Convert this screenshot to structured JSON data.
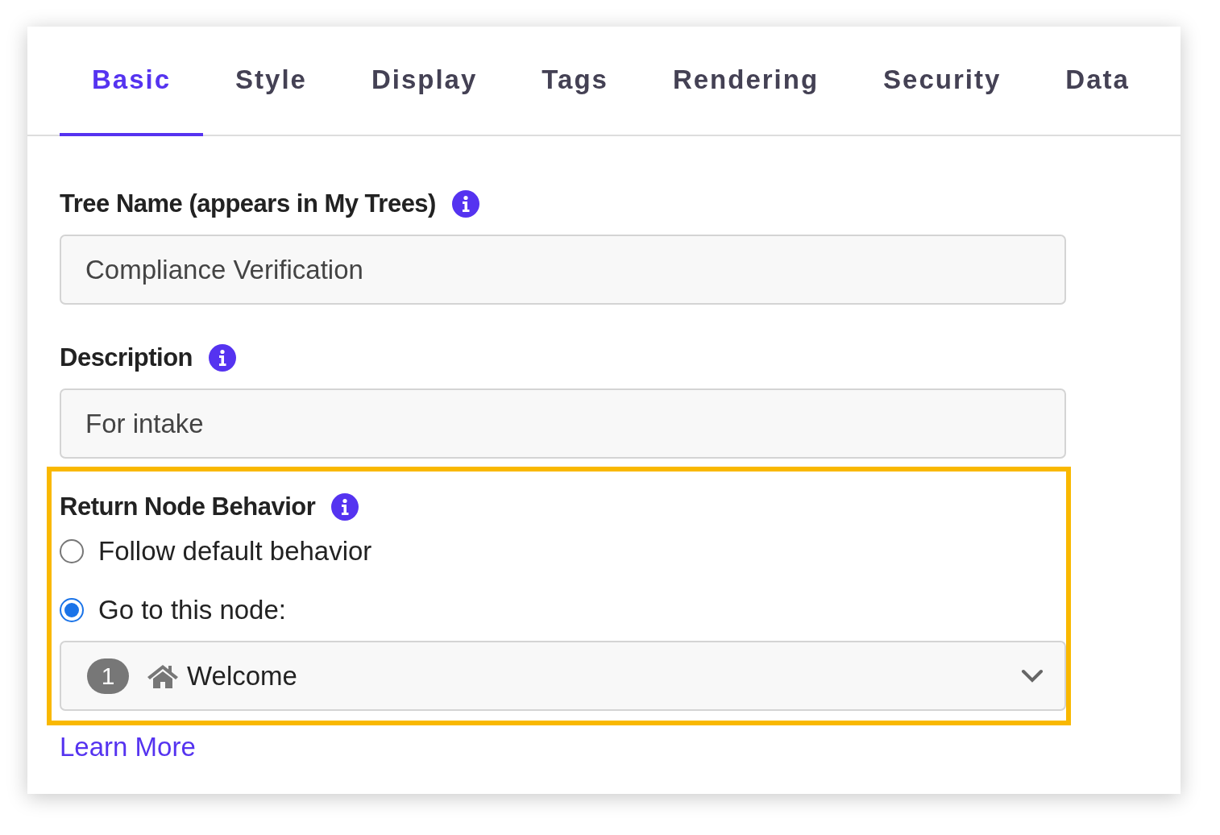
{
  "tabs": [
    {
      "label": "Basic",
      "selected": true
    },
    {
      "label": "Style",
      "selected": false
    },
    {
      "label": "Display",
      "selected": false
    },
    {
      "label": "Tags",
      "selected": false
    },
    {
      "label": "Rendering",
      "selected": false
    },
    {
      "label": "Security",
      "selected": false
    },
    {
      "label": "Data",
      "selected": false
    }
  ],
  "fields": [
    {
      "label": "Tree Name (appears in My Trees)",
      "value": "Compliance Verification"
    },
    {
      "label": "Description",
      "value": "For intake"
    }
  ],
  "return_node": {
    "label": "Return Node Behavior",
    "highlighted": true,
    "options": [
      {
        "label": "Follow default behavior",
        "selected": false
      },
      {
        "label": "Go to this node:",
        "selected": true
      }
    ],
    "node_select": {
      "badge": "1",
      "value": "Welcome"
    }
  },
  "learn_more": "Learn More"
}
